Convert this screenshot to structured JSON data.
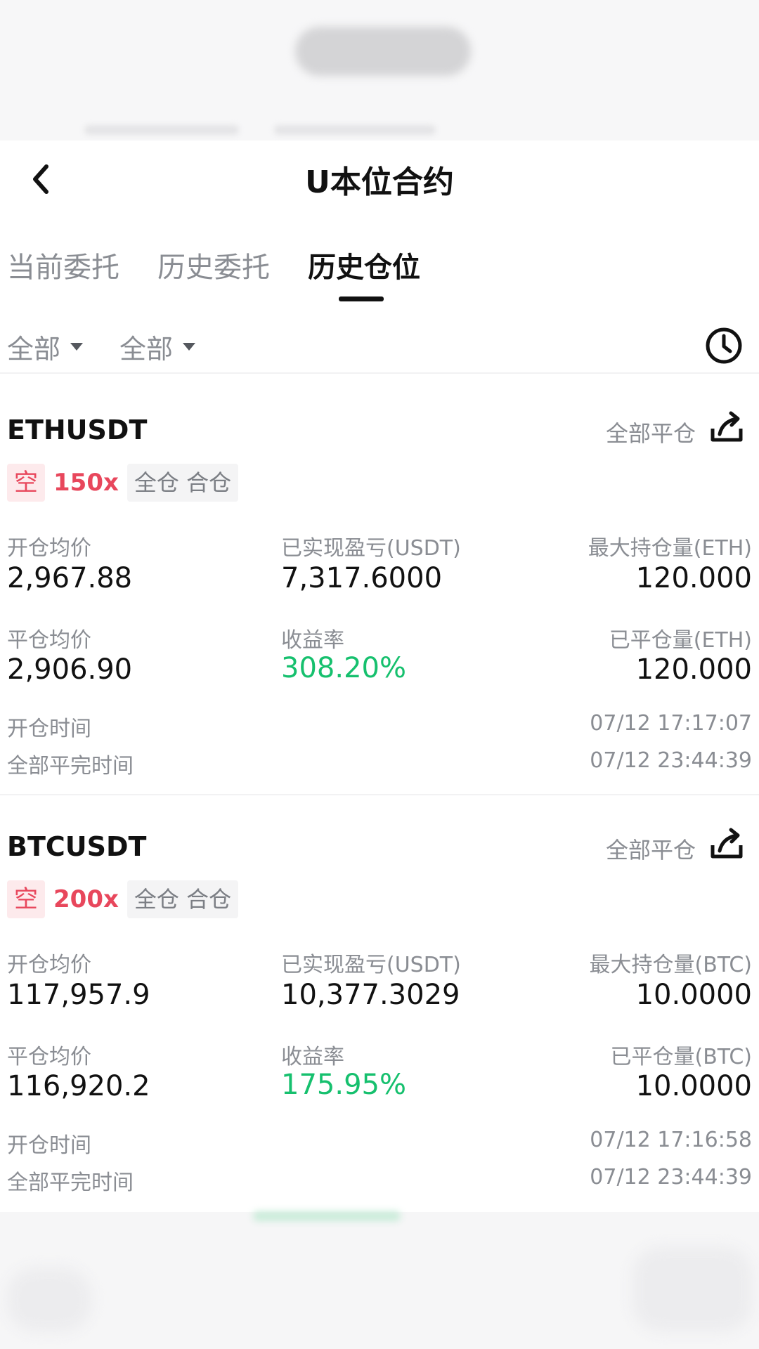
{
  "header": {
    "title": "U本位合约"
  },
  "tabs": [
    {
      "label": "当前委托"
    },
    {
      "label": "历史委托"
    },
    {
      "label": "历史仓位"
    }
  ],
  "filters": [
    {
      "label": "全部"
    },
    {
      "label": "全部"
    }
  ],
  "positions": [
    {
      "symbol": "ETHUSDT",
      "close_all_label": "全部平仓",
      "side": "空",
      "leverage": "150x",
      "mode": "全仓 合仓",
      "open_avg_label": "开仓均价",
      "open_avg": "2,967.88",
      "realized_pnl_label": "已实现盈亏(USDT)",
      "realized_pnl": "7,317.6000",
      "max_position_label": "最大持仓量(ETH)",
      "max_position": "120.000",
      "close_avg_label": "平仓均价",
      "close_avg": "2,906.90",
      "roi_label": "收益率",
      "roi": "308.20%",
      "closed_qty_label": "已平仓量(ETH)",
      "closed_qty": "120.000",
      "open_time_label": "开仓时间",
      "open_time": "07/12 17:17:07",
      "close_time_label": "全部平完时间",
      "close_time": "07/12 23:44:39"
    },
    {
      "symbol": "BTCUSDT",
      "close_all_label": "全部平仓",
      "side": "空",
      "leverage": "200x",
      "mode": "全仓 合仓",
      "open_avg_label": "开仓均价",
      "open_avg": "117,957.9",
      "realized_pnl_label": "已实现盈亏(USDT)",
      "realized_pnl": "10,377.3029",
      "max_position_label": "最大持仓量(BTC)",
      "max_position": "10.0000",
      "close_avg_label": "平仓均价",
      "close_avg": "116,920.2",
      "roi_label": "收益率",
      "roi": "175.95%",
      "closed_qty_label": "已平仓量(BTC)",
      "closed_qty": "10.0000",
      "open_time_label": "开仓时间",
      "open_time": "07/12 17:16:58",
      "close_time_label": "全部平完时间",
      "close_time": "07/12 23:44:39"
    }
  ],
  "colors": {
    "short_red": "#e8475c",
    "profit_green": "#16c06e",
    "muted_gray": "#8a8d93"
  }
}
